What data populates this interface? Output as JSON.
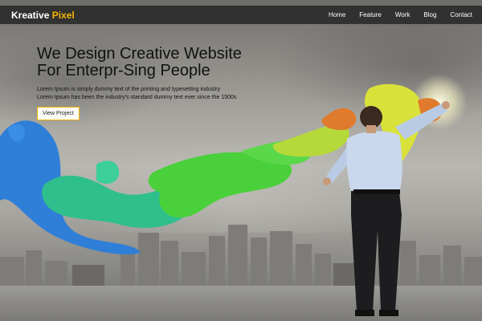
{
  "navbar": {
    "brand_main": "Kreative",
    "brand_accent": "Pixel",
    "links": [
      "Home",
      "Feature",
      "Work",
      "Blog",
      "Contact"
    ]
  },
  "hero": {
    "title_line1": "We Design Creative Website",
    "title_line2": "For Enterpr-Sing People",
    "text_line1": "Lorem Ipsum is simply dummy text of the printing and typesetting industry",
    "text_line2": "Lorem Ipsum has been the industry's standard dummy text ever since the 1500s",
    "cta_label": "View Project"
  },
  "colors": {
    "accent": "#f5b400",
    "navbar_bg": "#282828",
    "paint_blue": "#2f7fd8",
    "paint_teal": "#2fbf8c",
    "paint_green": "#4ad03a",
    "paint_yellow": "#d9e23a",
    "paint_orange": "#e07a2c"
  }
}
